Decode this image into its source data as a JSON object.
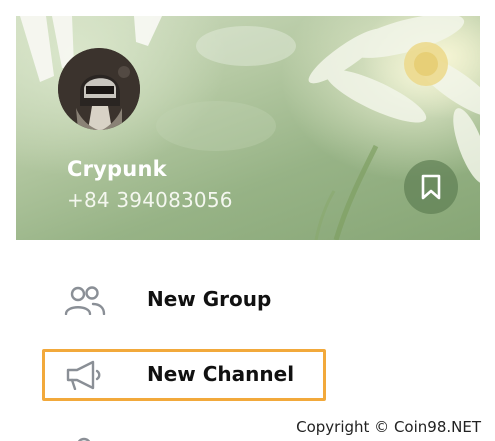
{
  "profile": {
    "name": "Crypunk",
    "phone": "+84 394083056"
  },
  "header": {
    "saved_icon": "bookmark-icon",
    "avatar_icon": "helmet-avatar"
  },
  "menu": {
    "items": [
      {
        "label": "New Group",
        "icon": "group-icon",
        "highlighted": false
      },
      {
        "label": "New Channel",
        "icon": "megaphone-icon",
        "highlighted": true
      }
    ]
  },
  "watermark": {
    "text": "Copyright © Coin98.NET"
  },
  "colors": {
    "highlight_border": "#f2a93b",
    "icon_gray": "#8a8f96",
    "saved_button": "#608054",
    "label_text": "#111111"
  }
}
